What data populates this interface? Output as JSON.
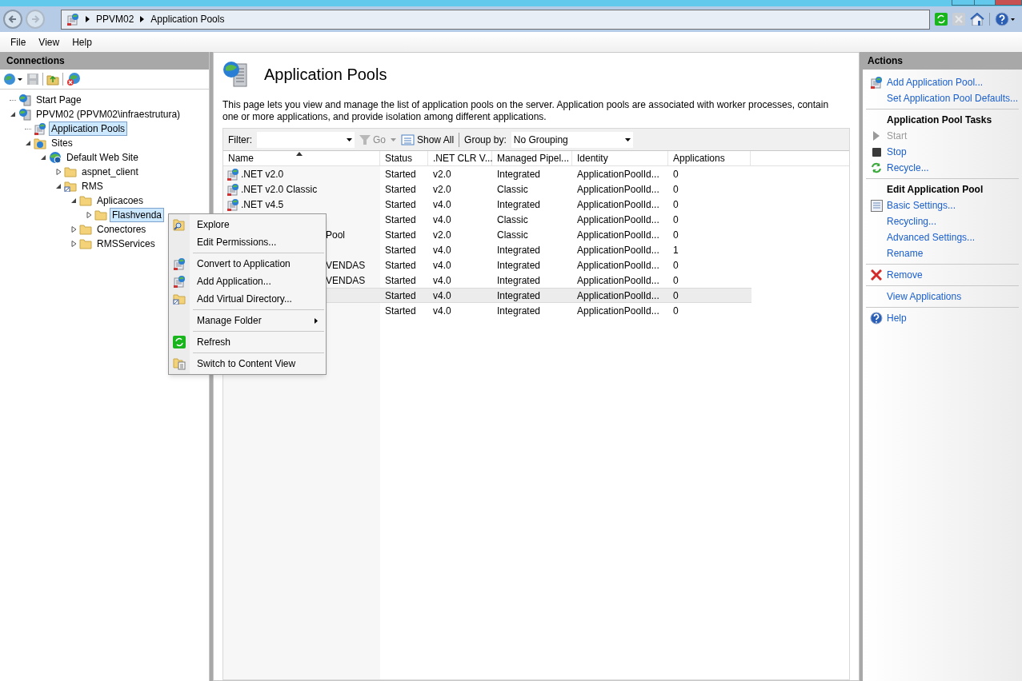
{
  "address_bar": {
    "crumbs": [
      "PPVM02",
      "Application Pools"
    ]
  },
  "menu_bar": [
    "File",
    "View",
    "Help"
  ],
  "connections": {
    "title": "Connections",
    "tree": [
      {
        "label": "Start Page",
        "selected": false
      },
      {
        "label": "PPVM02 (PPVM02\\infraestrutura)",
        "selected": false,
        "expanded": true,
        "children": [
          {
            "label": "Application Pools",
            "selected": true
          },
          {
            "label": "Sites",
            "selected": false,
            "expanded": true,
            "children": [
              {
                "label": "Default Web Site",
                "selected": false,
                "expanded": true,
                "children": [
                  {
                    "label": "aspnet_client",
                    "selected": false,
                    "expanded": false
                  },
                  {
                    "label": "RMS",
                    "selected": false,
                    "expanded": true,
                    "children": [
                      {
                        "label": "Aplicacoes",
                        "selected": false,
                        "expanded": true,
                        "children": [
                          {
                            "label": "Flashvenda",
                            "selected": true,
                            "expanded": false
                          }
                        ]
                      },
                      {
                        "label": "Conectores",
                        "selected": false,
                        "expanded": false
                      },
                      {
                        "label": "RMSServices",
                        "selected": false,
                        "expanded": false
                      }
                    ]
                  }
                ]
              }
            ]
          }
        ]
      }
    ]
  },
  "page": {
    "title": "Application Pools",
    "description": "This page lets you view and manage the list of application pools on the server. Application pools are associated with worker processes, contain one or more applications, and provide isolation among different applications.",
    "filter": {
      "label": "Filter:",
      "go": "Go",
      "go_disabled": true,
      "show_all": "Show All",
      "group_by_label": "Group by:",
      "group_by_value": "No Grouping"
    },
    "table": {
      "columns": [
        {
          "label": "Name",
          "sorted": true
        },
        {
          "label": "Status"
        },
        {
          "label": ".NET CLR V..."
        },
        {
          "label": "Managed Pipel..."
        },
        {
          "label": "Identity"
        },
        {
          "label": "Applications"
        }
      ],
      "rows": [
        {
          "covered": false,
          "selected": false,
          "cells": [
            ".NET v2.0",
            "Started",
            "v2.0",
            "Integrated",
            "ApplicationPoolId...",
            "0"
          ]
        },
        {
          "covered": false,
          "selected": false,
          "cells": [
            ".NET v2.0 Classic",
            "Started",
            "v2.0",
            "Classic",
            "ApplicationPoolId...",
            "0"
          ]
        },
        {
          "covered": false,
          "selected": false,
          "cells": [
            ".NET v4.5",
            "Started",
            "v4.0",
            "Integrated",
            "ApplicationPoolId...",
            "0"
          ]
        },
        {
          "selected": false,
          "cells": [
            "",
            "Started",
            "v4.0",
            "Classic",
            "ApplicationPoolId...",
            "0"
          ]
        },
        {
          "covered": true,
          "selected": false,
          "cells": [
            "Pool",
            "Started",
            "v2.0",
            "Classic",
            "ApplicationPoolId...",
            "0"
          ]
        },
        {
          "selected": false,
          "cells": [
            "",
            "Started",
            "v4.0",
            "Integrated",
            "ApplicationPoolId...",
            "1"
          ]
        },
        {
          "covered": true,
          "selected": false,
          "cells": [
            "VENDAS",
            "Started",
            "v4.0",
            "Integrated",
            "ApplicationPoolId...",
            "0"
          ]
        },
        {
          "covered": true,
          "selected": false,
          "cells": [
            "VENDAS",
            "Started",
            "v4.0",
            "Integrated",
            "ApplicationPoolId...",
            "0"
          ]
        },
        {
          "selected": true,
          "cells": [
            "",
            "Started",
            "v4.0",
            "Integrated",
            "ApplicationPoolId...",
            "0"
          ]
        },
        {
          "selected": false,
          "cells": [
            "",
            "Started",
            "v4.0",
            "Integrated",
            "ApplicationPoolId...",
            "0"
          ]
        }
      ]
    }
  },
  "context_menu": {
    "groups": [
      [
        {
          "label": "Explore"
        },
        {
          "label": "Edit Permissions..."
        }
      ],
      [
        {
          "label": "Convert to Application"
        },
        {
          "label": "Add Application..."
        },
        {
          "label": "Add Virtual Directory..."
        }
      ],
      [
        {
          "label": "Manage Folder",
          "submenu": true
        }
      ],
      [
        {
          "label": "Refresh"
        }
      ],
      [
        {
          "label": "Switch to Content View"
        }
      ]
    ]
  },
  "actions": {
    "title": "Actions",
    "groups": [
      {
        "items": [
          {
            "label": "Add Application Pool...",
            "disabled": false
          },
          {
            "label": "Set Application Pool Defaults...",
            "disabled": false
          }
        ]
      },
      {
        "heading": "Application Pool Tasks",
        "items": [
          {
            "label": "Start",
            "disabled": true
          },
          {
            "label": "Stop",
            "disabled": false
          },
          {
            "label": "Recycle...",
            "disabled": false
          }
        ]
      },
      {
        "heading": "Edit Application Pool",
        "items": [
          {
            "label": "Basic Settings...",
            "disabled": false
          },
          {
            "label": "Recycling...",
            "disabled": false
          },
          {
            "label": "Advanced Settings...",
            "disabled": false
          },
          {
            "label": "Rename",
            "disabled": false
          }
        ]
      },
      {
        "items": [
          {
            "label": "Remove",
            "disabled": false
          }
        ]
      },
      {
        "items": [
          {
            "label": "View Applications",
            "disabled": false
          }
        ]
      },
      {
        "items": [
          {
            "label": "Help",
            "disabled": false
          }
        ]
      }
    ]
  }
}
